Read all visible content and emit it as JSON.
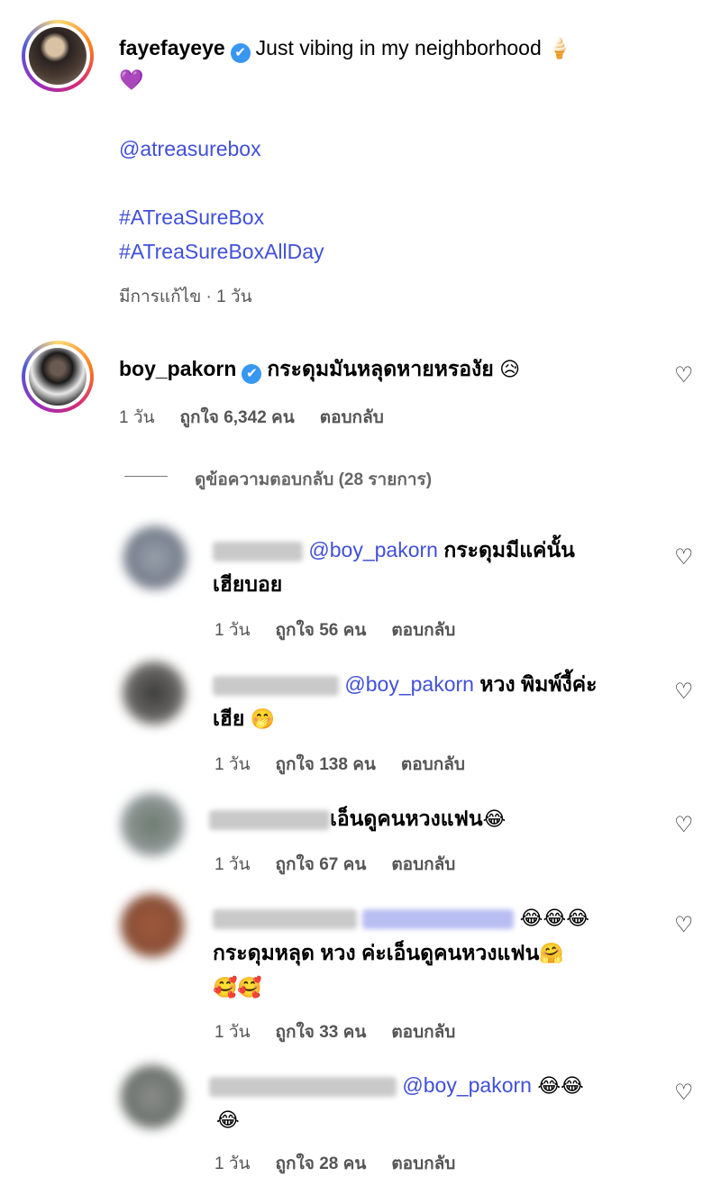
{
  "post": {
    "username": "fayefayeye",
    "caption": "Just vibing in my neighborhood",
    "caption_emojis": [
      "🍦",
      "💜"
    ],
    "mention": "@atreasurebox",
    "hashtag1": "#ATreaSureBox",
    "hashtag2": "#ATreaSureBoxAllDay",
    "edited_time": "มีการแก้ไข · 1 วัน"
  },
  "comment": {
    "username": "boy_pakorn",
    "text": "กระดุมมันหลุดหายหรองัย",
    "emoji": "😥",
    "time": "1 วัน",
    "likes": "ถูกใจ 6,342 คน",
    "reply": "ตอบกลับ",
    "view_replies": "ดูข้อความตอบกลับ (28 รายการ)"
  },
  "replies": [
    {
      "mention": "@boy_pakorn",
      "text1": "กระดุมมีแค่นั้น",
      "text2": "เฮียบอย",
      "time": "1 วัน",
      "likes": "ถูกใจ 56 คน",
      "reply": "ตอบกลับ"
    },
    {
      "mention": "@boy_pakorn",
      "text1": "หวง พิมพ์งี้ค่ะ",
      "text2": "เฮีย",
      "emoji": "🤭",
      "time": "1 วัน",
      "likes": "ถูกใจ 138 คน",
      "reply": "ตอบกลับ"
    },
    {
      "text1": "เอ็นดูคนหวงแฟน",
      "emoji": "😂",
      "time": "1 วัน",
      "likes": "ถูกใจ 67 คน",
      "reply": "ตอบกลับ"
    },
    {
      "emoji": "😂😂😂",
      "text1": "กระดุมหลุด หวง ค่ะเอ็นดูคนหวงแฟน",
      "emoji2": "🤗",
      "emoji3": "🥰🥰",
      "time": "1 วัน",
      "likes": "ถูกใจ 33 คน",
      "reply": "ตอบกลับ"
    },
    {
      "mention": "@boy_pakorn",
      "emoji": "😂😂",
      "emoji2": "😂",
      "time": "1 วัน",
      "likes": "ถูกใจ 28 คน",
      "reply": "ตอบกลับ"
    }
  ],
  "icons": {
    "verified": "✔",
    "heart": "♡"
  }
}
